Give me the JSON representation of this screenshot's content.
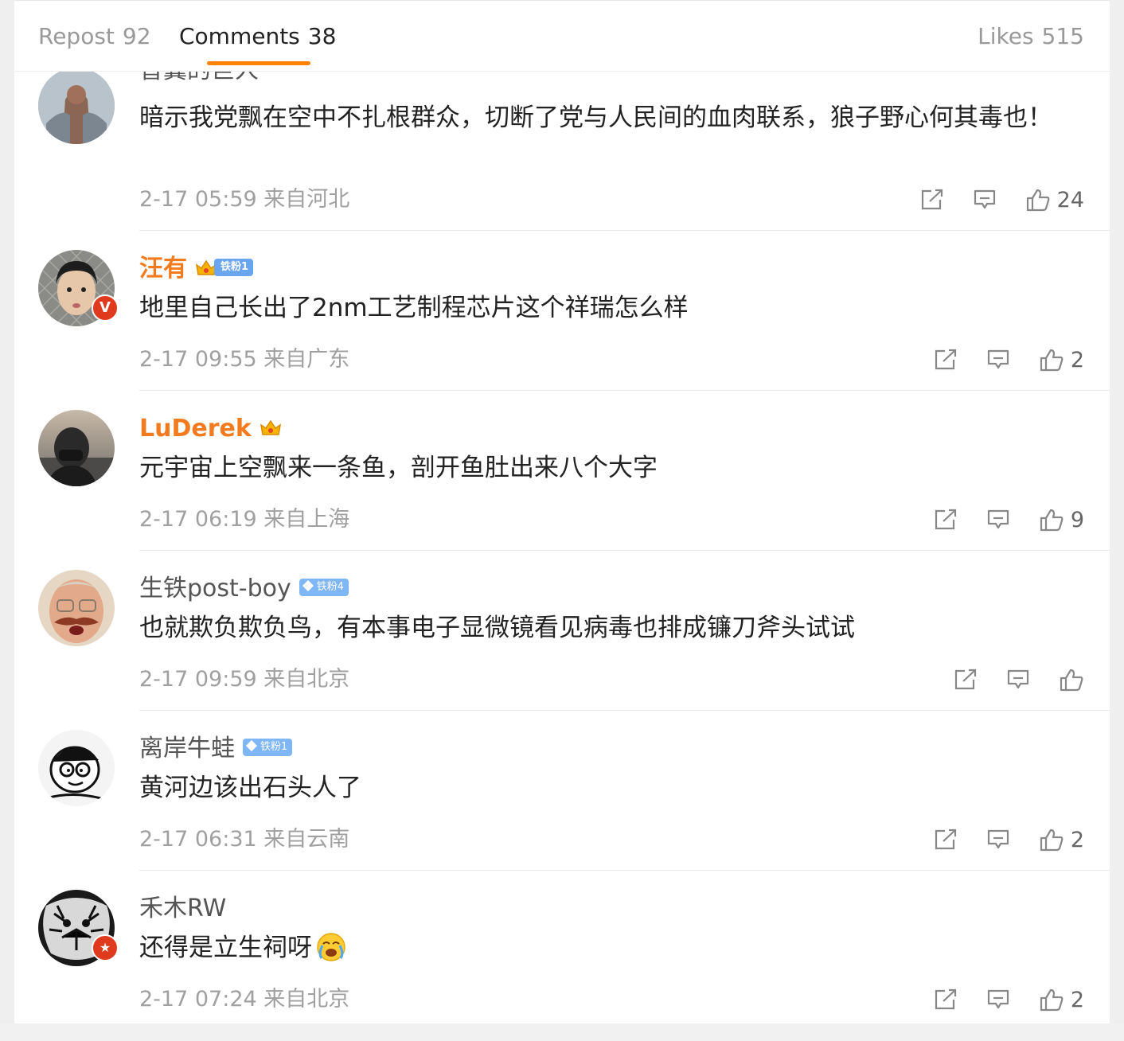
{
  "tabs": {
    "repost": {
      "label": "Repost",
      "count": "92"
    },
    "comments": {
      "label": "Comments",
      "count": "38"
    },
    "likes": {
      "label": "Likes",
      "count": "515"
    }
  },
  "colors": {
    "accent": "#ff8200",
    "vip_name": "#f27b1f",
    "fan_badge": "#7fb6f5",
    "verified_red": "#e03a1e"
  },
  "comments": [
    {
      "username": "普翼的巨人",
      "text": "暗示我党飘在空中不扎根群众，切断了党与人民间的血肉联系，狼子野心何其毒也！",
      "time": "2-17 05:59",
      "location": "来自河北",
      "likes": "24"
    },
    {
      "username": "汪有",
      "badge": "铁粉1",
      "text": "地里自己长出了2nm工艺制程芯片这个祥瑞怎么样",
      "time": "2-17 09:55",
      "location": "来自广东",
      "likes": "2",
      "avatar_badge": "V"
    },
    {
      "username": "LuDerek",
      "text": "元宇宙上空飘来一条鱼，剖开鱼肚出来八个大字",
      "time": "2-17 06:19",
      "location": "来自上海",
      "likes": "9"
    },
    {
      "username": "生铁post-boy",
      "badge": "铁粉4",
      "text": "也就欺负欺负鸟，有本事电子显微镜看见病毒也排成镰刀斧头试试",
      "time": "2-17 09:59",
      "location": "来自北京",
      "likes": ""
    },
    {
      "username": "离岸牛蛙",
      "badge": "铁粉1",
      "text": "黄河边该出石头人了",
      "time": "2-17 06:31",
      "location": "来自云南",
      "likes": "2"
    },
    {
      "username": "禾木RW",
      "text": "还得是立生祠呀",
      "time": "2-17 07:24",
      "location": "来自北京",
      "likes": "2",
      "avatar_badge": "★"
    }
  ]
}
